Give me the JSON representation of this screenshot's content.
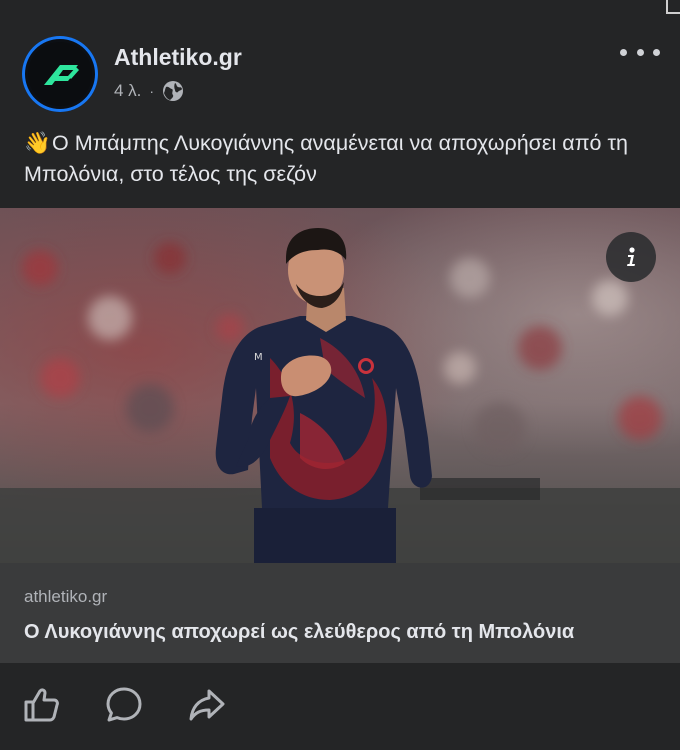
{
  "post": {
    "page_name": "Athletiko.gr",
    "time": "4 λ.",
    "separator": "·",
    "audience_icon": "globe-icon",
    "emoji": "👋",
    "text": "Ο Μπάμπης Λυκογιάννης αναμένεται να αποχωρήσει από τη Μπολόνια, στο τέλος της σεζόν"
  },
  "link": {
    "domain": "athletiko.gr",
    "title": "Ο Λυκογιάννης αποχωρεί ως ελεύθερος από τη Μπολόνια"
  },
  "icons": {
    "more": "more-dots-icon",
    "info": "info-icon",
    "like": "thumbs-up-icon",
    "comment": "comment-icon",
    "share": "share-icon"
  },
  "colors": {
    "background": "#242526",
    "link_card": "#3a3b3c",
    "avatar_ring": "#1877f2",
    "logo_green": "#2ee59d",
    "text": "#e4e6eb",
    "muted": "#b0b3b8"
  }
}
